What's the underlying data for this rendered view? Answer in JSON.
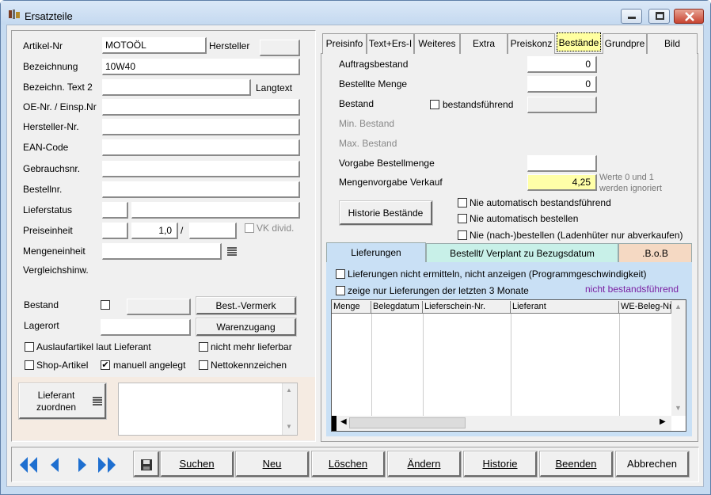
{
  "window": {
    "title": "Ersatzteile"
  },
  "left": {
    "labels": {
      "artikel_nr": "Artikel-Nr",
      "hersteller": "Hersteller",
      "bezeichnung": "Bezeichnung",
      "bez_text2": "Bezeichn. Text 2",
      "langtext": "Langtext",
      "oe_nr": "OE-Nr. / Einsp.Nr",
      "hersteller_nr": "Hersteller-Nr.",
      "ean": "EAN-Code",
      "gebrauchsnr": "Gebrauchsnr.",
      "bestellnr": "Bestellnr.",
      "lieferstatus": "Lieferstatus",
      "preiseinheit": "Preiseinheit",
      "vk_divid": "VK divid.",
      "mengeneinheit": "Mengeneinheit",
      "vergleich": "Vergleichshinw.",
      "bestand": "Bestand",
      "lagerort": "Lagerort"
    },
    "values": {
      "artikel_nr": "MOTOÖL",
      "bezeichnung": "10W40",
      "preiseinheit": "1,0",
      "preis_slash": "/"
    },
    "buttons": {
      "best_vermerk": "Best.-Vermerk",
      "warenzugang": "Warenzugang",
      "lieferant_zuordnen_1": "Lieferant",
      "lieferant_zuordnen_2": "zuordnen"
    },
    "checks": {
      "auslauf": "Auslaufartikel laut Lieferant",
      "nicht_lieferbar": "nicht mehr lieferbar",
      "shop": "Shop-Artikel",
      "manuell": "manuell angelegt",
      "netto": "Nettokennzeichen",
      "manuell_checked": "✔"
    }
  },
  "tabs": [
    "Preisinfo",
    "Text+Ers-I",
    "Weiteres",
    "Extra",
    "Preiskonz",
    "Bestände",
    "Grundpre",
    "Bild"
  ],
  "bestaende": {
    "auftragsbestand": "Auftragsbestand",
    "auftragsbestand_val": "0",
    "bestellte_menge": "Bestellte Menge",
    "bestellte_menge_val": "0",
    "bestand": "Bestand",
    "bestandsfuehrend": "bestandsführend",
    "min_bestand": "Min. Bestand",
    "max_bestand": "Max. Bestand",
    "vorgabe_bestellmenge": "Vorgabe Bestellmenge",
    "mengenvorgabe": "Mengenvorgabe Verkauf",
    "mengenvorgabe_val": "4,25",
    "hint1": "Werte 0 und 1",
    "hint2": "werden ignoriert",
    "historie_btn": "Historie Bestände",
    "nie_auto_bestand": "Nie automatisch bestandsführend",
    "nie_auto_bestellen": "Nie automatisch bestellen",
    "nie_nachbestellen": "Nie (nach-)bestellen (Ladenhüter nur abverkaufen)"
  },
  "subtabs": [
    "Lieferungen",
    "Bestellt/ Verplant zu Bezugsdatum",
    ".B.o.B"
  ],
  "lieferungen": {
    "chk1": "Lieferungen nicht ermitteln, nicht anzeigen (Programmgeschwindigkeit)",
    "chk2": "zeige nur Lieferungen der letzten 3 Monate",
    "status": "nicht bestandsführend",
    "columns": [
      "Menge",
      "Belegdatum",
      "Lieferschein-Nr.",
      "Lieferant",
      "WE-Beleg-Nr"
    ]
  },
  "toolbar": {
    "suchen": "Suchen",
    "neu": "Neu",
    "loeschen": "Löschen",
    "aendern": "Ändern",
    "historie": "Historie",
    "beenden": "Beenden",
    "abbrechen": "Abbrechen"
  },
  "colors": {
    "nav_arrow": "#1e6fd0",
    "status_purple": "#7a1fa2",
    "highlight_yellow": "#ffffa8",
    "subtab_active": "#c9e0f5",
    "subtab_mid": "#c8f0e8",
    "subtab_last": "#f5d9c3"
  }
}
